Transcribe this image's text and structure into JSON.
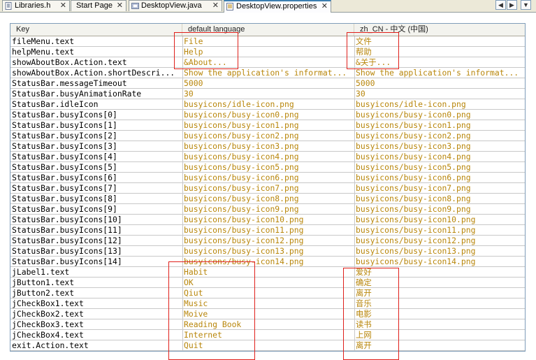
{
  "tabs": [
    {
      "label": "Libraries.h",
      "icon": "header-file-icon",
      "active": false
    },
    {
      "label": "Start Page",
      "icon": "",
      "active": false
    },
    {
      "label": "DesktopView.java",
      "icon": "java-file-icon",
      "active": false
    },
    {
      "label": "DesktopView.properties",
      "icon": "properties-file-icon",
      "active": true
    }
  ],
  "tab_close": "✕",
  "nav": {
    "left": "◀",
    "right": "▶",
    "menu": "▼"
  },
  "table": {
    "columns": [
      "Key",
      "default language",
      "zh_CN - 中文 (中国)"
    ],
    "rows": [
      [
        "fileMenu.text",
        "File",
        "文件"
      ],
      [
        "helpMenu.text",
        "Help",
        "帮助"
      ],
      [
        "showAboutBox.Action.text",
        "&About...",
        "&关于..."
      ],
      [
        "showAboutBox.Action.shortDescri...",
        "Show the application's informat...",
        "Show the application's informat..."
      ],
      [
        "StatusBar.messageTimeout",
        "5000",
        "5000"
      ],
      [
        "StatusBar.busyAnimationRate",
        "30",
        "30"
      ],
      [
        "StatusBar.idleIcon",
        "busyicons/idle-icon.png",
        "busyicons/idle-icon.png"
      ],
      [
        "StatusBar.busyIcons[0]",
        "busyicons/busy-icon0.png",
        "busyicons/busy-icon0.png"
      ],
      [
        "StatusBar.busyIcons[1]",
        "busyicons/busy-icon1.png",
        "busyicons/busy-icon1.png"
      ],
      [
        "StatusBar.busyIcons[2]",
        "busyicons/busy-icon2.png",
        "busyicons/busy-icon2.png"
      ],
      [
        "StatusBar.busyIcons[3]",
        "busyicons/busy-icon3.png",
        "busyicons/busy-icon3.png"
      ],
      [
        "StatusBar.busyIcons[4]",
        "busyicons/busy-icon4.png",
        "busyicons/busy-icon4.png"
      ],
      [
        "StatusBar.busyIcons[5]",
        "busyicons/busy-icon5.png",
        "busyicons/busy-icon5.png"
      ],
      [
        "StatusBar.busyIcons[6]",
        "busyicons/busy-icon6.png",
        "busyicons/busy-icon6.png"
      ],
      [
        "StatusBar.busyIcons[7]",
        "busyicons/busy-icon7.png",
        "busyicons/busy-icon7.png"
      ],
      [
        "StatusBar.busyIcons[8]",
        "busyicons/busy-icon8.png",
        "busyicons/busy-icon8.png"
      ],
      [
        "StatusBar.busyIcons[9]",
        "busyicons/busy-icon9.png",
        "busyicons/busy-icon9.png"
      ],
      [
        "StatusBar.busyIcons[10]",
        "busyicons/busy-icon10.png",
        "busyicons/busy-icon10.png"
      ],
      [
        "StatusBar.busyIcons[11]",
        "busyicons/busy-icon11.png",
        "busyicons/busy-icon11.png"
      ],
      [
        "StatusBar.busyIcons[12]",
        "busyicons/busy-icon12.png",
        "busyicons/busy-icon12.png"
      ],
      [
        "StatusBar.busyIcons[13]",
        "busyicons/busy-icon13.png",
        "busyicons/busy-icon13.png"
      ],
      [
        "StatusBar.busyIcons[14]",
        "busyicons/busy-icon14.png",
        "busyicons/busy-icon14.png"
      ],
      [
        "jLabel1.text",
        "Habit",
        "爱好"
      ],
      [
        "jButton1.text",
        "OK",
        "确定"
      ],
      [
        "jButton2.text",
        "Qiut",
        "离开"
      ],
      [
        "jCheckBox1.text",
        "Music",
        "音乐"
      ],
      [
        "jCheckBox2.text",
        "Moive",
        "电影"
      ],
      [
        "jCheckBox3.text",
        "Reading Book",
        "读书"
      ],
      [
        "jCheckBox4.text",
        "Internet",
        "上网"
      ],
      [
        "exit.Action.text",
        "Quit",
        "离开"
      ]
    ]
  },
  "colors": {
    "value_text": "#b8860b",
    "annotation": "#e0201b",
    "active_tab_accent": "#3c7fb1"
  }
}
